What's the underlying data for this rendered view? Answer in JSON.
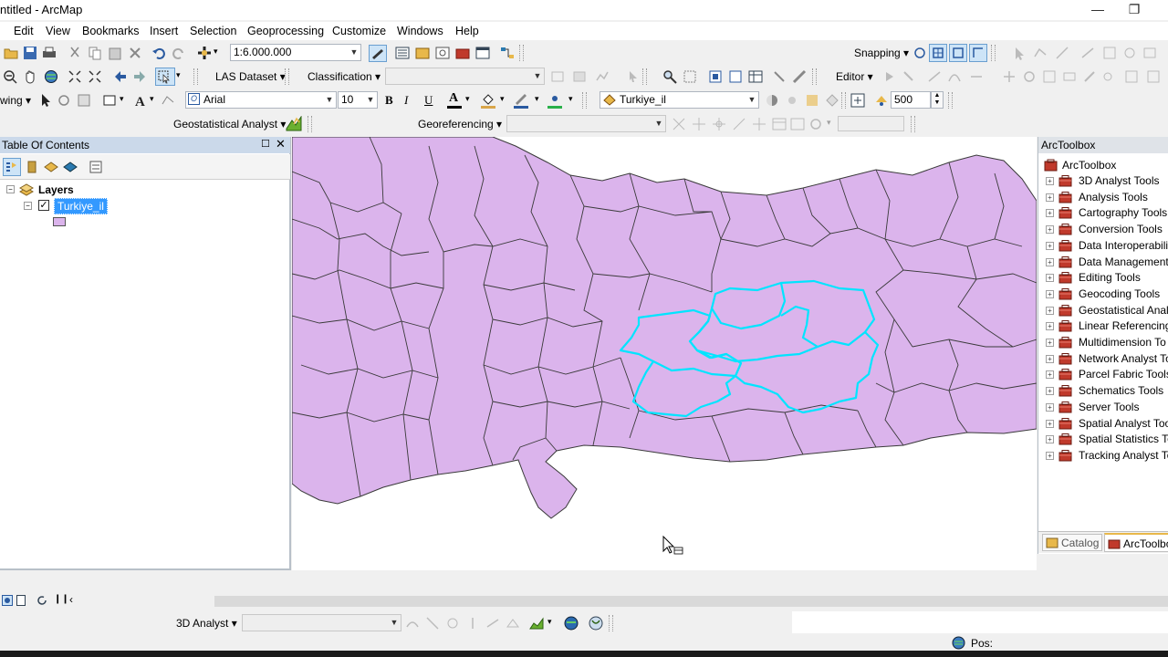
{
  "window": {
    "title": "ntitled - ArcMap",
    "minimize_glyph": "—",
    "restore_glyph": "❐"
  },
  "menu": [
    "Edit",
    "View",
    "Bookmarks",
    "Insert",
    "Selection",
    "Geoprocessing",
    "Customize",
    "Windows",
    "Help"
  ],
  "standard_toolbar": {
    "scale_value": "1:6.000.000"
  },
  "las_toolbar": {
    "las_dataset_label": "LAS Dataset ▾",
    "classification_label": "Classification ▾"
  },
  "snapping_toolbar": {
    "label": "Snapping ▾"
  },
  "editor_toolbar": {
    "label": "Editor ▾"
  },
  "drawing_toolbar": {
    "label_fragment": "wing ▾",
    "font_name": "Arial",
    "font_size": "10",
    "bold": "B",
    "italic": "I",
    "underline": "U",
    "font_color_glyph": "A"
  },
  "effects_toolbar": {
    "layer_value": "Turkiye_il",
    "value_500": "500"
  },
  "geostat_toolbar": {
    "label": "Geostatistical Analyst ▾"
  },
  "georef_toolbar": {
    "label": "Georeferencing ▾"
  },
  "toc": {
    "title": "Table Of Contents",
    "layers_group": "Layers",
    "layer_name": "Turkiye_il",
    "layer_checked": true,
    "layer_fill_color": "#dbb4ec"
  },
  "map": {
    "fill_color": "#dbb4ec",
    "outline_color": "#3a3a3a",
    "selection_color": "#00e5ff"
  },
  "arctoolbox": {
    "title": "ArcToolbox",
    "root": "ArcToolbox",
    "items": [
      "3D Analyst Tools",
      "Analysis Tools",
      "Cartography Tools",
      "Conversion Tools",
      "Data Interoperabilit",
      "Data Management",
      "Editing Tools",
      "Geocoding Tools",
      "Geostatistical Analy",
      "Linear Referencing",
      "Multidimension To",
      "Network Analyst To",
      "Parcel Fabric Tools",
      "Schematics Tools",
      "Server Tools",
      "Spatial Analyst Too",
      "Spatial Statistics To",
      "Tracking Analyst To"
    ],
    "tabs": [
      "Catalog",
      "ArcToolbo"
    ]
  },
  "analyst3d_toolbar": {
    "label": "3D Analyst ▾"
  },
  "status": {
    "position_label": "Pos:"
  }
}
